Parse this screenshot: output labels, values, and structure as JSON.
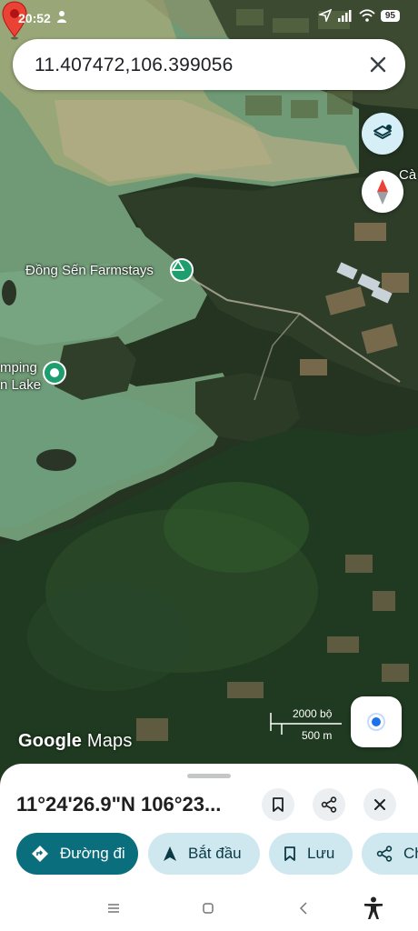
{
  "status_bar": {
    "time": "20:52",
    "battery": "95"
  },
  "search": {
    "query": "11.407472,106.399056"
  },
  "map": {
    "labels": {
      "dong_sen": "Đồng Sến Farmstays",
      "camping_line1": "mping",
      "camping_line2": "n Lake",
      "edge": "Cà"
    },
    "scale": {
      "imperial": "2000 bộ",
      "metric": "500 m"
    },
    "watermark_google": "Google",
    "watermark_maps": "Maps"
  },
  "place_sheet": {
    "title": "11°24'26.9\"N 106°23...",
    "actions": {
      "directions": "Đường đi",
      "start": "Bắt đầu",
      "save": "Lưu",
      "share": "Ch"
    }
  },
  "colors": {
    "accent": "#0b6e7d",
    "chip": "#cfe8f0",
    "pin": "#ea4335",
    "poi": "#1e9e6e",
    "location": "#1a73e8"
  }
}
